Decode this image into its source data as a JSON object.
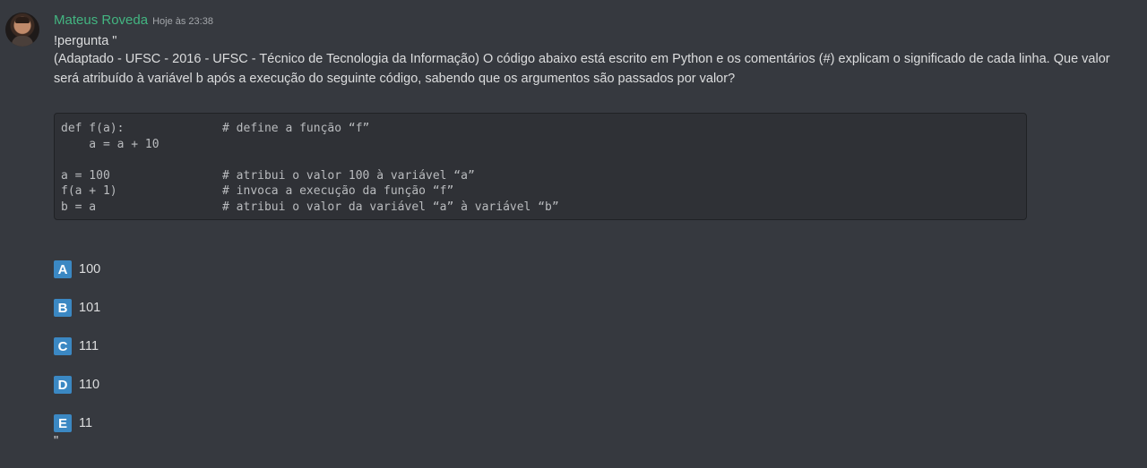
{
  "message": {
    "author": "Mateus Roveda",
    "timestamp": "Hoje às 23:38",
    "line1": "!pergunta \"",
    "line2": "(Adaptado - UFSC - 2016 - UFSC - Técnico de Tecnologia da Informação) O código abaixo está escrito em Python e os comentários (#) explicam o significado de cada linha. Que valor",
    "line3": "será atribuído à variável b após a execução do seguinte código, sabendo que os argumentos são passados por valor?",
    "code": "def f(a):              # define a função “f”\n    a = a + 10\n\na = 100                # atribui o valor 100 à variável “a”\nf(a + 1)               # invoca a execução da função “f”\nb = a                  # atribui o valor da variável “a” à variável “b”",
    "options": [
      {
        "letter": "A",
        "value": "100"
      },
      {
        "letter": "B",
        "value": "101"
      },
      {
        "letter": "C",
        "value": "111"
      },
      {
        "letter": "D",
        "value": "110"
      },
      {
        "letter": "E",
        "value": "11"
      }
    ],
    "closing": "\""
  },
  "colors": {
    "background": "#36393f",
    "username": "#43b581",
    "emoji_letter": "#3b88c3",
    "codeblock_bg": "#2f3136"
  },
  "icons": {
    "avatar": "user-avatar-photo",
    "option_letters": "regional-indicator-emoji"
  }
}
